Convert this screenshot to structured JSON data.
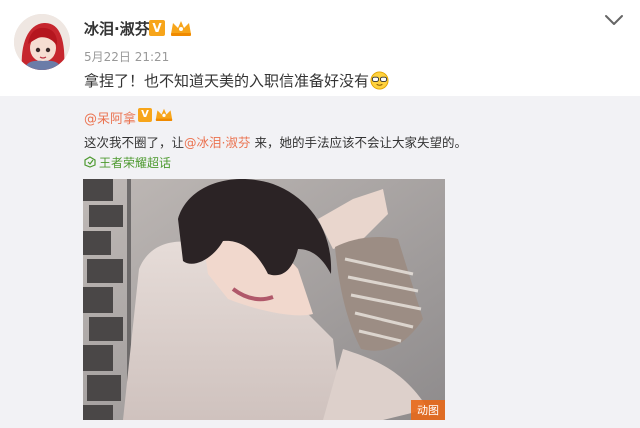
{
  "post": {
    "username": "冰泪·淑芬",
    "verified_mark": "V",
    "timestamp": "5月22日 21:21",
    "content": "拿捏了！也不知道天美的入职信准备好没有",
    "emoji": "sunglasses-emoji",
    "menu_icon": "chevron-down-icon"
  },
  "repost": {
    "author": "@呆阿拿",
    "verified_mark": "V",
    "text_before": "这次我不圈了，让",
    "mention": "@冰泪·淑芬",
    "text_after": " 来，她的手法应该不会让大家失望的。",
    "topic": "王者荣耀超话",
    "media_badge": "动图"
  },
  "colors": {
    "accent": "#eb7350",
    "topic_green": "#4d9a2f",
    "repost_bg": "#f2f2f5",
    "badge_orange": "#f7a51a"
  }
}
